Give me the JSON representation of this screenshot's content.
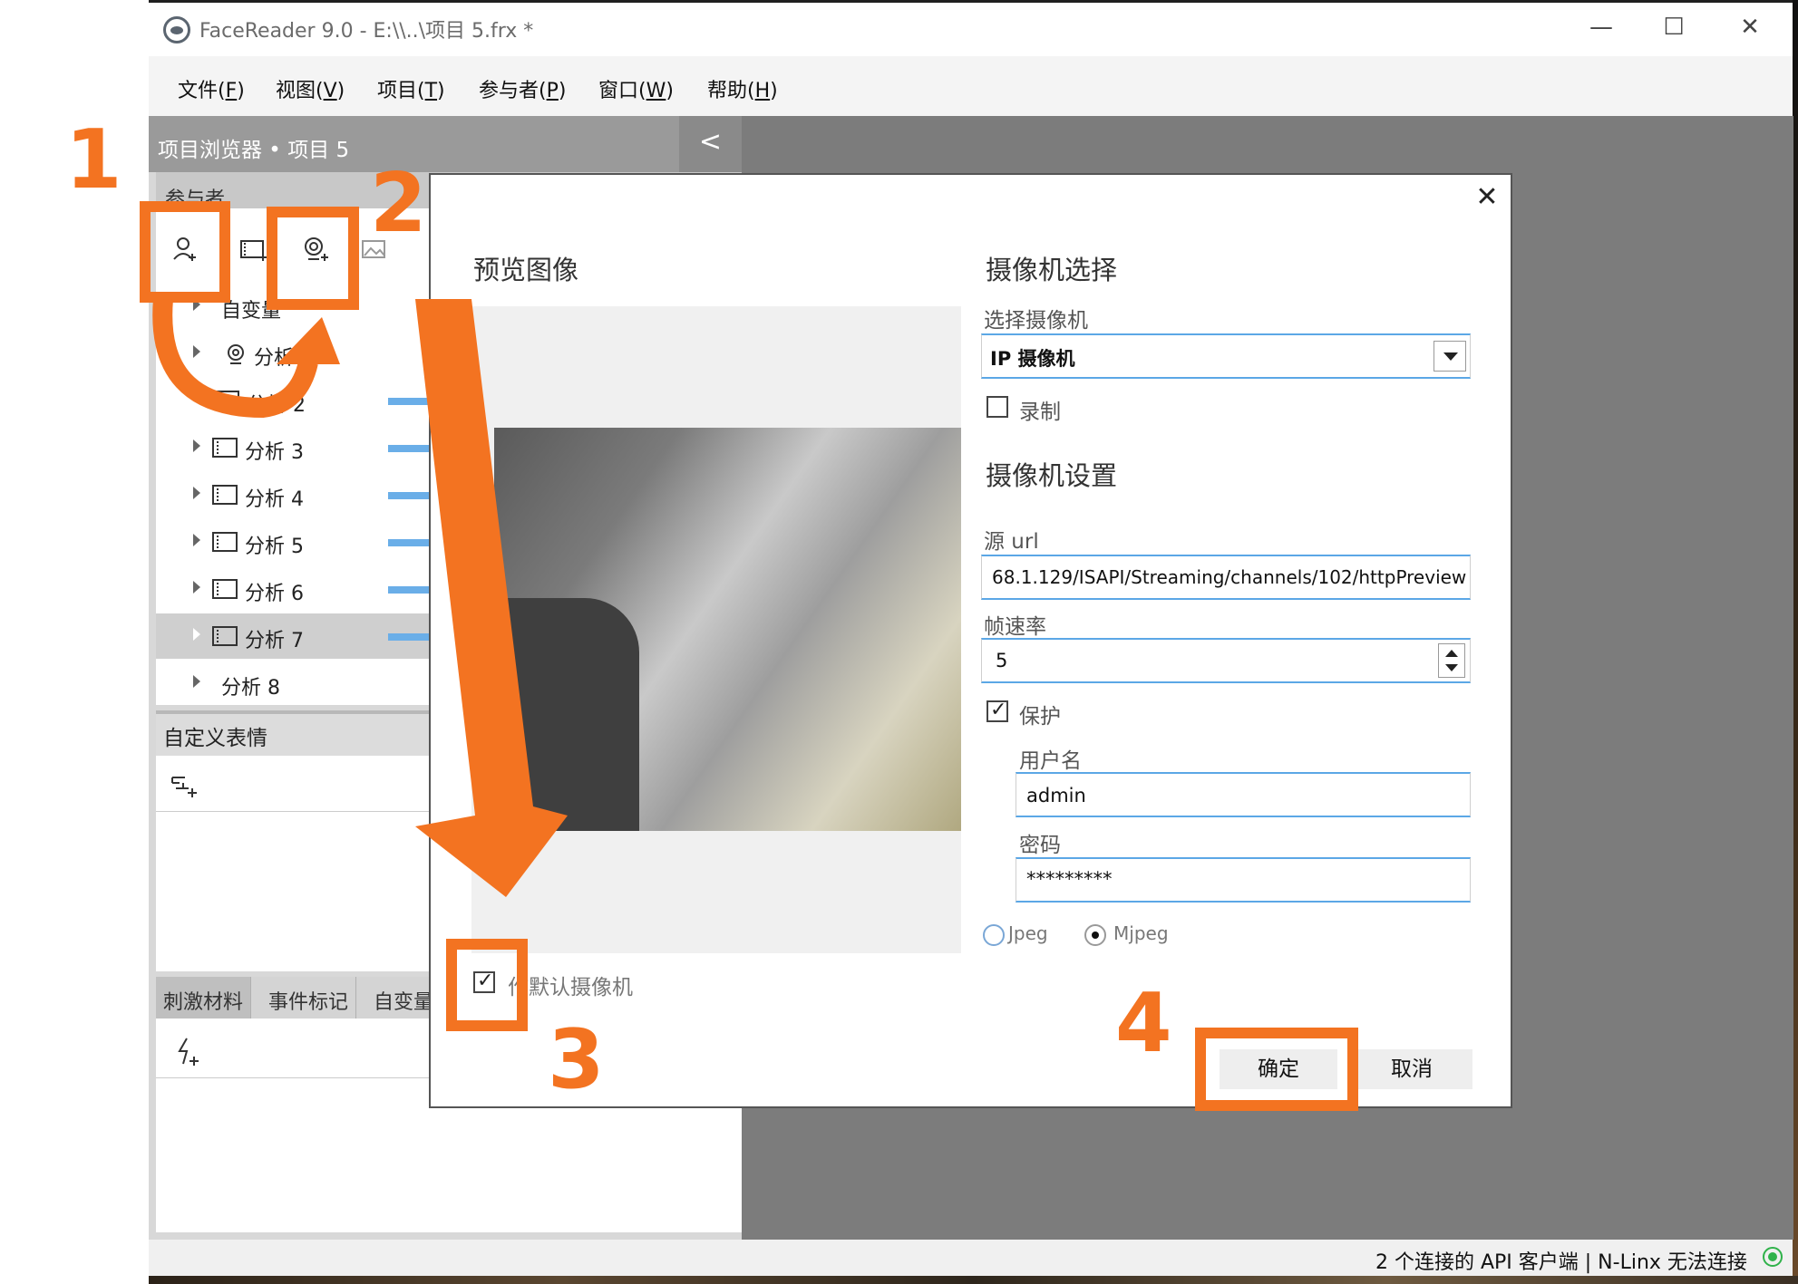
{
  "window": {
    "title": "FaceReader 9.0 - E:\\\\..\\项目 5.frx *",
    "minimize": "—",
    "maximize": "☐",
    "close": "✕"
  },
  "menu": [
    {
      "label": "文件(",
      "key": "F",
      "end": ")"
    },
    {
      "label": "视图(",
      "key": "V",
      "end": ")"
    },
    {
      "label": "项目(",
      "key": "T",
      "end": ")"
    },
    {
      "label": "参与者(",
      "key": "P",
      "end": ")"
    },
    {
      "label": "窗口(",
      "key": "W",
      "end": ")"
    },
    {
      "label": "帮助(",
      "key": "H",
      "end": ")"
    }
  ],
  "panel": {
    "title": "项目浏览器 • 项目 5",
    "collapse": "<",
    "participants_label": "参与者",
    "tree": [
      {
        "label": "自变量",
        "icon": "none"
      },
      {
        "label": "分析",
        "icon": "webcam-icon"
      },
      {
        "label": "分析 2",
        "icon": "film-icon"
      },
      {
        "label": "分析 3",
        "icon": "film-icon"
      },
      {
        "label": "分析 4",
        "icon": "film-icon"
      },
      {
        "label": "分析 5",
        "icon": "film-icon"
      },
      {
        "label": "分析 6",
        "icon": "film-icon"
      },
      {
        "label": "分析 7",
        "icon": "film-icon",
        "selected": true
      },
      {
        "label": "分析 8",
        "icon": "none"
      }
    ],
    "custom_expr_label": "自定义表情",
    "tabs": [
      "刺激材料",
      "事件标记",
      "自变量"
    ]
  },
  "status": {
    "text": "2 个连接的 API 客户端 | N-Linx 无法连接"
  },
  "dialog": {
    "close": "✕",
    "preview_title": "预览图像",
    "camera_select_title": "摄像机选择",
    "select_camera_label": "选择摄像机",
    "camera_value": "IP 摄像机",
    "record_label": "录制",
    "record_checked": false,
    "camera_settings_title": "摄像机设置",
    "source_url_label": "源 url",
    "source_url_value": "68.1.129/ISAPI/Streaming/channels/102/httpPreview",
    "framerate_label": "帧速率",
    "framerate_value": "5",
    "protect_label": "保护",
    "protect_checked": true,
    "username_label": "用户名",
    "username_value": "admin",
    "password_label": "密码",
    "password_value": "*********",
    "format_options": [
      "Jpeg",
      "Mjpeg"
    ],
    "format_selected": "Mjpeg",
    "default_camera_label": "用作默认摄像机",
    "default_camera_visible": "作默认摄像机",
    "default_camera_checked": true,
    "ok": "确定",
    "cancel": "取消"
  },
  "annotations": {
    "color": "#f37321",
    "steps": [
      "1",
      "2",
      "3",
      "4"
    ]
  }
}
